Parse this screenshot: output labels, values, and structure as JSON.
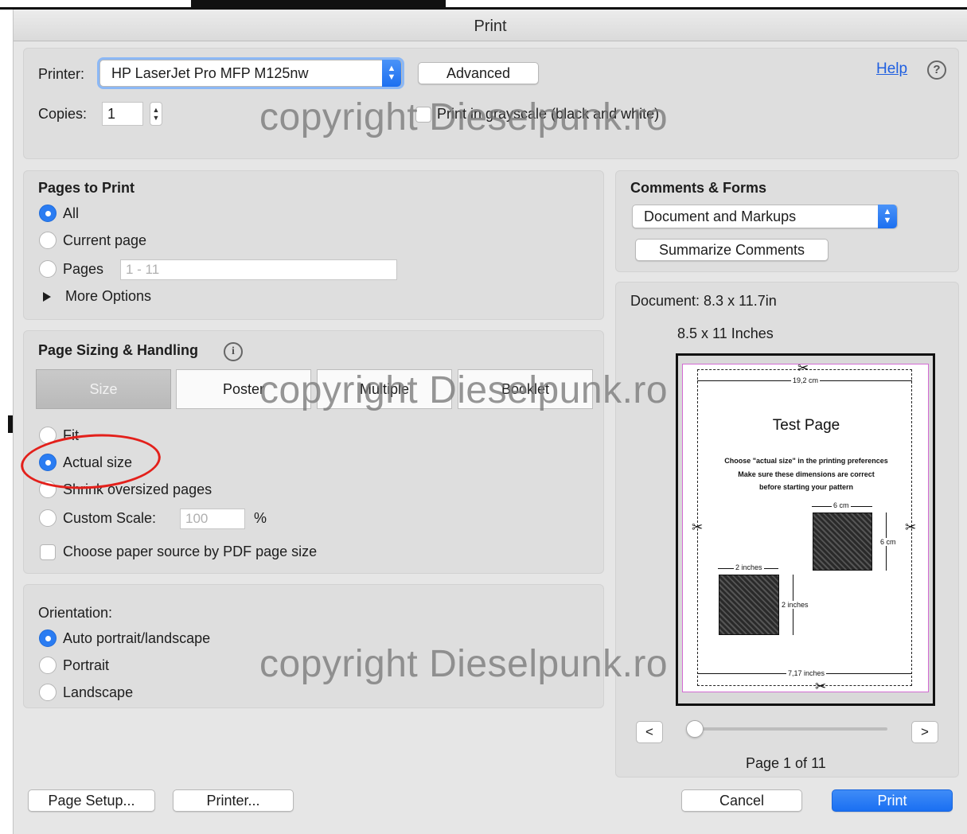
{
  "window": {
    "title": "Print"
  },
  "printer_section": {
    "printer_label": "Printer:",
    "printer_value": "HP LaserJet Pro MFP M125nw",
    "advanced_button": "Advanced",
    "help_link": "Help",
    "copies_label": "Copies:",
    "copies_value": "1",
    "grayscale_label": "Print in grayscale (black and white)",
    "grayscale_checked": false
  },
  "pages_to_print": {
    "title": "Pages to Print",
    "options": [
      {
        "label": "All",
        "selected": true
      },
      {
        "label": "Current page",
        "selected": false
      },
      {
        "label": "Pages",
        "selected": false
      }
    ],
    "pages_placeholder": "1 - 11",
    "more_options": "More Options"
  },
  "page_sizing": {
    "title": "Page Sizing & Handling",
    "info_icon": "info-icon",
    "tabs": [
      {
        "label": "Size",
        "selected": true
      },
      {
        "label": "Poster",
        "selected": false
      },
      {
        "label": "Multiple",
        "selected": false
      },
      {
        "label": "Booklet",
        "selected": false
      }
    ],
    "options": [
      {
        "label": "Fit",
        "selected": false
      },
      {
        "label": "Actual size",
        "selected": true
      },
      {
        "label": "Shrink oversized pages",
        "selected": false
      },
      {
        "label": "Custom Scale:",
        "selected": false
      }
    ],
    "scale_placeholder": "100",
    "scale_unit": "%",
    "paper_source_label": "Choose paper source by PDF page size",
    "paper_source_checked": false
  },
  "orientation": {
    "title": "Orientation:",
    "options": [
      {
        "label": "Auto portrait/landscape",
        "selected": true
      },
      {
        "label": "Portrait",
        "selected": false
      },
      {
        "label": "Landscape",
        "selected": false
      }
    ]
  },
  "comments_forms": {
    "title": "Comments & Forms",
    "value": "Document and Markups",
    "summarize_button": "Summarize Comments"
  },
  "preview": {
    "document_size": "Document: 8.3 x 11.7in",
    "paper_size": "8.5 x 11 Inches",
    "page": {
      "title": "Test Page",
      "lines": [
        "Choose \"actual size\" in the printing preferences",
        "Make sure these dimensions are correct",
        "before starting your pattern"
      ],
      "top_measure": "19,2 cm",
      "bottom_measure": "7,17 inches",
      "cm_square_width": "6 cm",
      "cm_square_height": "6 cm",
      "inch_square_width": "2 inches",
      "inch_square_height": "2 inches"
    },
    "prev_button": "<",
    "next_button": ">",
    "page_indicator": "Page 1 of 11"
  },
  "footer": {
    "page_setup_button": "Page Setup...",
    "printer_button": "Printer...",
    "cancel_button": "Cancel",
    "print_button": "Print"
  },
  "watermark": "copyright Dieselpunk.ro",
  "colors": {
    "accent": "#1a6ff2",
    "annotation": "#e3201b",
    "link": "#1f5fe0"
  }
}
